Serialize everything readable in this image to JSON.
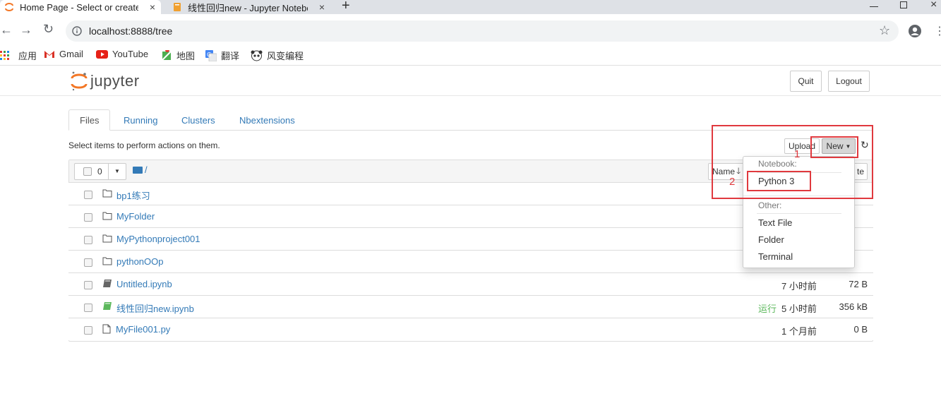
{
  "browser": {
    "tabs": [
      {
        "title": "Home Page - Select or create a",
        "close": "×"
      },
      {
        "title": "线性回归new - Jupyter Notebo",
        "close": "×"
      }
    ],
    "new_tab": "+",
    "url": "localhost:8888/tree",
    "bookmarks": [
      {
        "label": "应用"
      },
      {
        "label": "Gmail"
      },
      {
        "label": "YouTube"
      },
      {
        "label": "地图"
      },
      {
        "label": "翻译"
      },
      {
        "label": "风变编程"
      }
    ]
  },
  "jupyter": {
    "logo": "jupyter",
    "quit": "Quit",
    "logout": "Logout",
    "tabs": [
      "Files",
      "Running",
      "Clusters",
      "Nbextensions"
    ],
    "instructions": "Select items to perform actions on them.",
    "upload": "Upload",
    "new": "New",
    "selected_count": "0",
    "path": "/",
    "name_col": "Name",
    "name_col_suffix": "te",
    "files": [
      {
        "name": "bp1练习",
        "type": "folder",
        "time": "",
        "size": "",
        "status": ""
      },
      {
        "name": "MyFolder",
        "type": "folder",
        "time": "",
        "size": "",
        "status": ""
      },
      {
        "name": "MyPythonproject001",
        "type": "folder",
        "time": "",
        "size": "",
        "status": ""
      },
      {
        "name": "pythonOOp",
        "type": "folder",
        "time": "",
        "size": "",
        "status": ""
      },
      {
        "name": "Untitled.ipynb",
        "type": "notebook",
        "time": "7 小时前",
        "size": "72 B",
        "status": ""
      },
      {
        "name": "线性回归new.ipynb",
        "type": "notebook-running",
        "time": "5 小时前",
        "size": "356 kB",
        "status": "运行"
      },
      {
        "name": "MyFile001.py",
        "type": "file",
        "time": "1 个月前",
        "size": "0 B",
        "status": ""
      }
    ],
    "new_menu": {
      "notebook_header": "Notebook:",
      "python3": "Python 3",
      "other_header": "Other:",
      "text_file": "Text File",
      "folder": "Folder",
      "terminal": "Terminal"
    }
  },
  "annotations": {
    "label1": "1",
    "label2": "2",
    "color": "#e0393e"
  },
  "colors": {
    "link": "#337ab7",
    "running": "#5cb85c",
    "jupyter_orange": "#f37726"
  }
}
